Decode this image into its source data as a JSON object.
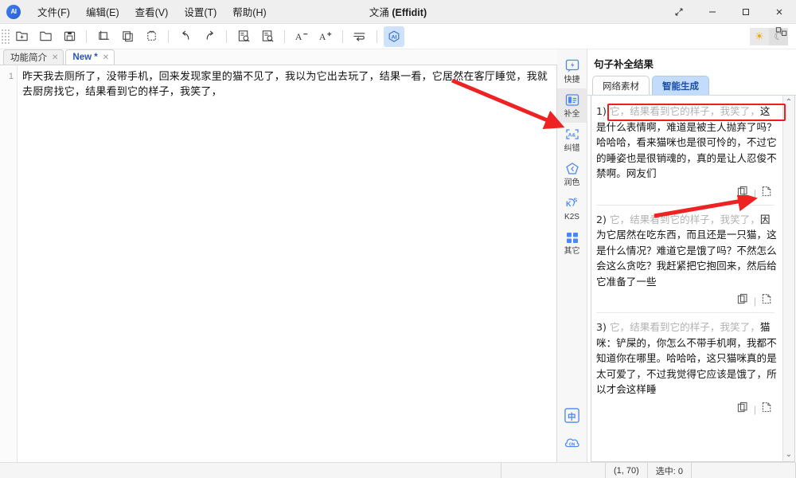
{
  "window": {
    "title_cn": "文涌",
    "title_en": "(Effidit)",
    "logo_text": "AI",
    "controls": {
      "expand": "⤢",
      "minimize": "—",
      "maximize": "▢",
      "close": "✕"
    }
  },
  "menu": [
    {
      "label": "文件(F)",
      "name": "menu-file"
    },
    {
      "label": "编辑(E)",
      "name": "menu-edit"
    },
    {
      "label": "查看(V)",
      "name": "menu-view"
    },
    {
      "label": "设置(T)",
      "name": "menu-settings"
    },
    {
      "label": "帮助(H)",
      "name": "menu-help"
    }
  ],
  "toolbar": {
    "buttons": [
      {
        "name": "new-file-icon",
        "glyph": "new-doc"
      },
      {
        "name": "open-folder-icon",
        "glyph": "open"
      },
      {
        "name": "save-icon",
        "glyph": "save"
      },
      {
        "name": "cut-icon",
        "glyph": "cut"
      },
      {
        "name": "copy-icon",
        "glyph": "copy"
      },
      {
        "name": "paste-icon",
        "glyph": "paste"
      },
      {
        "name": "undo-icon",
        "glyph": "undo"
      },
      {
        "name": "redo-icon",
        "glyph": "redo"
      },
      {
        "name": "find-icon",
        "glyph": "find"
      },
      {
        "name": "replace-icon",
        "glyph": "replace"
      },
      {
        "name": "font-decrease-icon",
        "glyph": "A-"
      },
      {
        "name": "font-increase-icon",
        "glyph": "A+"
      },
      {
        "name": "wrap-lines-icon",
        "glyph": "wrap"
      },
      {
        "name": "ai-assistant-icon",
        "glyph": "ai"
      }
    ],
    "theme_light": "☀",
    "theme_dark": "☾",
    "layout_toggle": "layout-icon"
  },
  "doc_tabs": [
    {
      "label": "功能简介",
      "close": "✕",
      "active": false
    },
    {
      "label": "New *",
      "close": "✕",
      "active": true
    }
  ],
  "editor": {
    "line_number": "1",
    "content": "昨天我去厕所了，没带手机，回来发现家里的猫不见了，我以为它出去玩了，结果一看，它居然在客厅睡觉，我就去厨房找它，结果看到它的样子，我笑了，"
  },
  "rail": {
    "items": [
      {
        "label": "快捷",
        "icon": "lightning-icon",
        "active": false
      },
      {
        "label": "补全",
        "icon": "complete-icon",
        "active": true
      },
      {
        "label": "纠错",
        "icon": "spellcheck-icon",
        "active": false
      },
      {
        "label": "润色",
        "icon": "polish-icon",
        "active": false
      },
      {
        "label": "K2S",
        "icon": "k2s-icon",
        "active": false
      },
      {
        "label": "其它",
        "icon": "grid-icon",
        "active": false
      }
    ],
    "bottom": [
      {
        "label": "中",
        "name": "language-chinese-icon"
      },
      {
        "label": "ON",
        "name": "cloud-on-icon"
      }
    ]
  },
  "panel": {
    "title": "句子补全结果",
    "tabs": [
      {
        "label": "网络素材",
        "active": false
      },
      {
        "label": "智能生成",
        "active": true
      }
    ],
    "scrollbar": {
      "up": "⌃",
      "down": "⌄"
    },
    "results": [
      {
        "index": "1)",
        "prefix": "它，结果看到它的样子，我笑了，",
        "text": "这是什么表情啊，难道是被主人抛弃了吗？哈哈哈，看来猫咪也是很可怜的，不过它的睡姿也是很销魂的，真的是让人忍俊不禁啊。网友们",
        "actions": {
          "copy": "copy-icon",
          "insert": "insert-icon"
        }
      },
      {
        "index": "2)",
        "prefix": "它，结果看到它的样子，我笑了，",
        "text": "因为它居然在吃东西，而且还是一只猫，这是什么情况？难道它是饿了吗？不然怎么会这么贪吃？我赶紧把它抱回来，然后给它准备了一些",
        "actions": {
          "copy": "copy-icon",
          "insert": "insert-icon"
        }
      },
      {
        "index": "3)",
        "prefix": "它，结果看到它的样子，我笑了，",
        "text": "猫咪：铲屎的，你怎么不带手机啊，我都不知道你在哪里。哈哈哈，这只猫咪真的是太可爱了，不过我觉得它应该是饿了，所以才会这样睡",
        "actions": {
          "copy": "copy-icon",
          "insert": "insert-icon"
        }
      }
    ]
  },
  "status": {
    "cursor": "(1, 70)",
    "selection": "选中: 0"
  },
  "colors": {
    "accent": "#4a86f7",
    "tab_active": "#c3dcfb",
    "highlight": "#f41b1b",
    "arrow": "#ee2222"
  }
}
